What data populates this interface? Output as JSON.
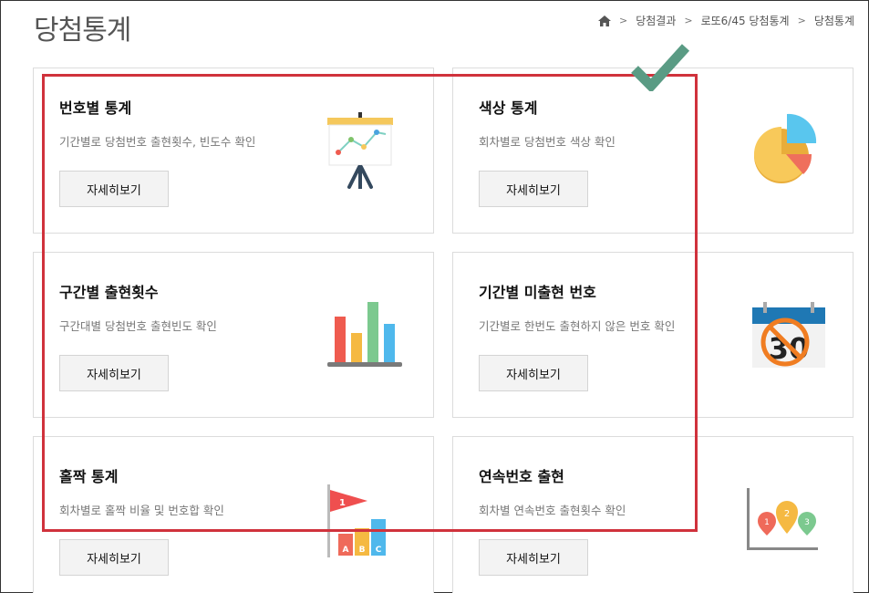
{
  "page": {
    "title": "당첨통계"
  },
  "breadcrumb": {
    "home_icon": "home-icon",
    "items": [
      "당첨결과",
      "로또6/45 당첨통계",
      "당첨통계"
    ]
  },
  "cards": [
    {
      "title": "번호별 통계",
      "desc": "기간별로 당첨번호 출현횟수, 빈도수 확인",
      "button": "자세히보기",
      "icon": "presentation-chart-icon"
    },
    {
      "title": "색상 통계",
      "desc": "회차별로 당첨번호 색상 확인",
      "button": "자세히보기",
      "icon": "pie-chart-icon"
    },
    {
      "title": "구간별 출현횟수",
      "desc": "구간대별 당첨번호 출현빈도 확인",
      "button": "자세히보기",
      "icon": "bar-chart-icon"
    },
    {
      "title": "기간별 미출현 번호",
      "desc": "기간별로 한번도 출현하지 않은 번호 확인",
      "button": "자세히보기",
      "icon": "calendar-no-icon"
    },
    {
      "title": "홀짝 통계",
      "desc": "회차별로 홀짝 비율 및 번호합 확인",
      "button": "자세히보기",
      "icon": "flag-blocks-icon"
    },
    {
      "title": "연속번호 출현",
      "desc": "회차별 연속번호 출현횟수 확인",
      "button": "자세히보기",
      "icon": "map-pins-chart-icon"
    }
  ],
  "illustration_text": {
    "calendar_number": "30",
    "flag_number": "1",
    "blocks": [
      "A",
      "B",
      "C"
    ],
    "pins": [
      "1",
      "2",
      "3"
    ]
  },
  "colors": {
    "highlight_box": "#d0323c",
    "check_mark": "#5a9b84"
  }
}
